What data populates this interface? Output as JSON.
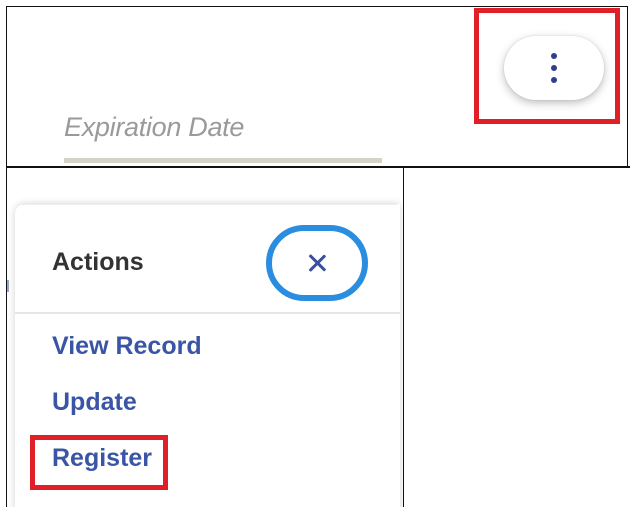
{
  "form": {
    "expiration_label": "Expiration Date"
  },
  "kebab": {
    "icon": "more-vertical-icon"
  },
  "actions_menu": {
    "title": "Actions",
    "close_icon": "close-icon",
    "items": [
      {
        "label": "View Record"
      },
      {
        "label": "Update"
      },
      {
        "label": "Register"
      }
    ]
  },
  "colors": {
    "highlight_red": "#e01f26",
    "focus_blue": "#2a8de0",
    "link_blue": "#3b55a6",
    "title_gray": "#333333",
    "placeholder_gray": "#9a9a9a"
  }
}
